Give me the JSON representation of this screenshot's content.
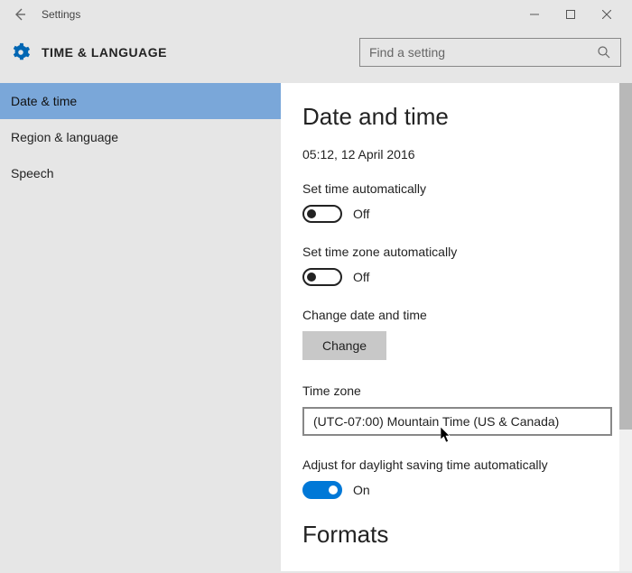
{
  "window": {
    "title": "Settings"
  },
  "header": {
    "title": "TIME & LANGUAGE",
    "search_placeholder": "Find a setting"
  },
  "sidebar": {
    "items": [
      {
        "label": "Date & time",
        "selected": true
      },
      {
        "label": "Region & language",
        "selected": false
      },
      {
        "label": "Speech",
        "selected": false
      }
    ]
  },
  "content": {
    "page_title": "Date and time",
    "current_datetime": "05:12, 12 April 2016",
    "set_time_auto_label": "Set time automatically",
    "set_time_auto_state": "Off",
    "set_tz_auto_label": "Set time zone automatically",
    "set_tz_auto_state": "Off",
    "change_dt_label": "Change date and time",
    "change_button": "Change",
    "tz_label": "Time zone",
    "tz_value": "(UTC-07:00) Mountain Time (US & Canada)",
    "dst_label": "Adjust for daylight saving time automatically",
    "dst_state": "On",
    "formats_title": "Formats"
  }
}
